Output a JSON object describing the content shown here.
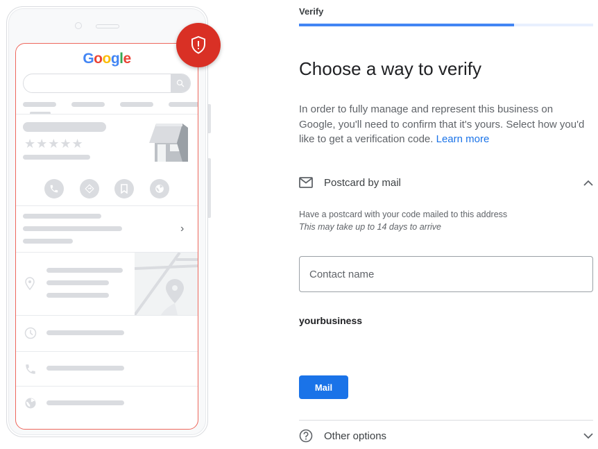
{
  "illustration": {
    "logo_letters": [
      "G",
      "o",
      "o",
      "g",
      "l",
      "e"
    ],
    "stars": "★★★★★",
    "chevron": "›",
    "badge_icon": "shield-alert-icon"
  },
  "stepper": {
    "label": "Verify",
    "progress_percent": 73
  },
  "page": {
    "title": "Choose a way to verify",
    "description": "In order to fully manage and represent this business on Google, you'll need to confirm that it's yours. Select how you'd like to get a verification code.",
    "learn_more": "Learn more"
  },
  "postcard_section": {
    "label": "Postcard by mail",
    "icon": "mail-icon",
    "expanded": true,
    "subtitle": "Have a postcard with your code mailed to this address",
    "note": "This may take up to 14 days to arrive",
    "contact_placeholder": "Contact name",
    "contact_value": "",
    "business_name": "yourbusiness",
    "mail_button": "Mail"
  },
  "other_section": {
    "label": "Other options",
    "icon": "help-icon",
    "expanded": false
  },
  "colors": {
    "accent": "#1a73e8",
    "progress": "#4285f4",
    "alert": "#d93025"
  }
}
